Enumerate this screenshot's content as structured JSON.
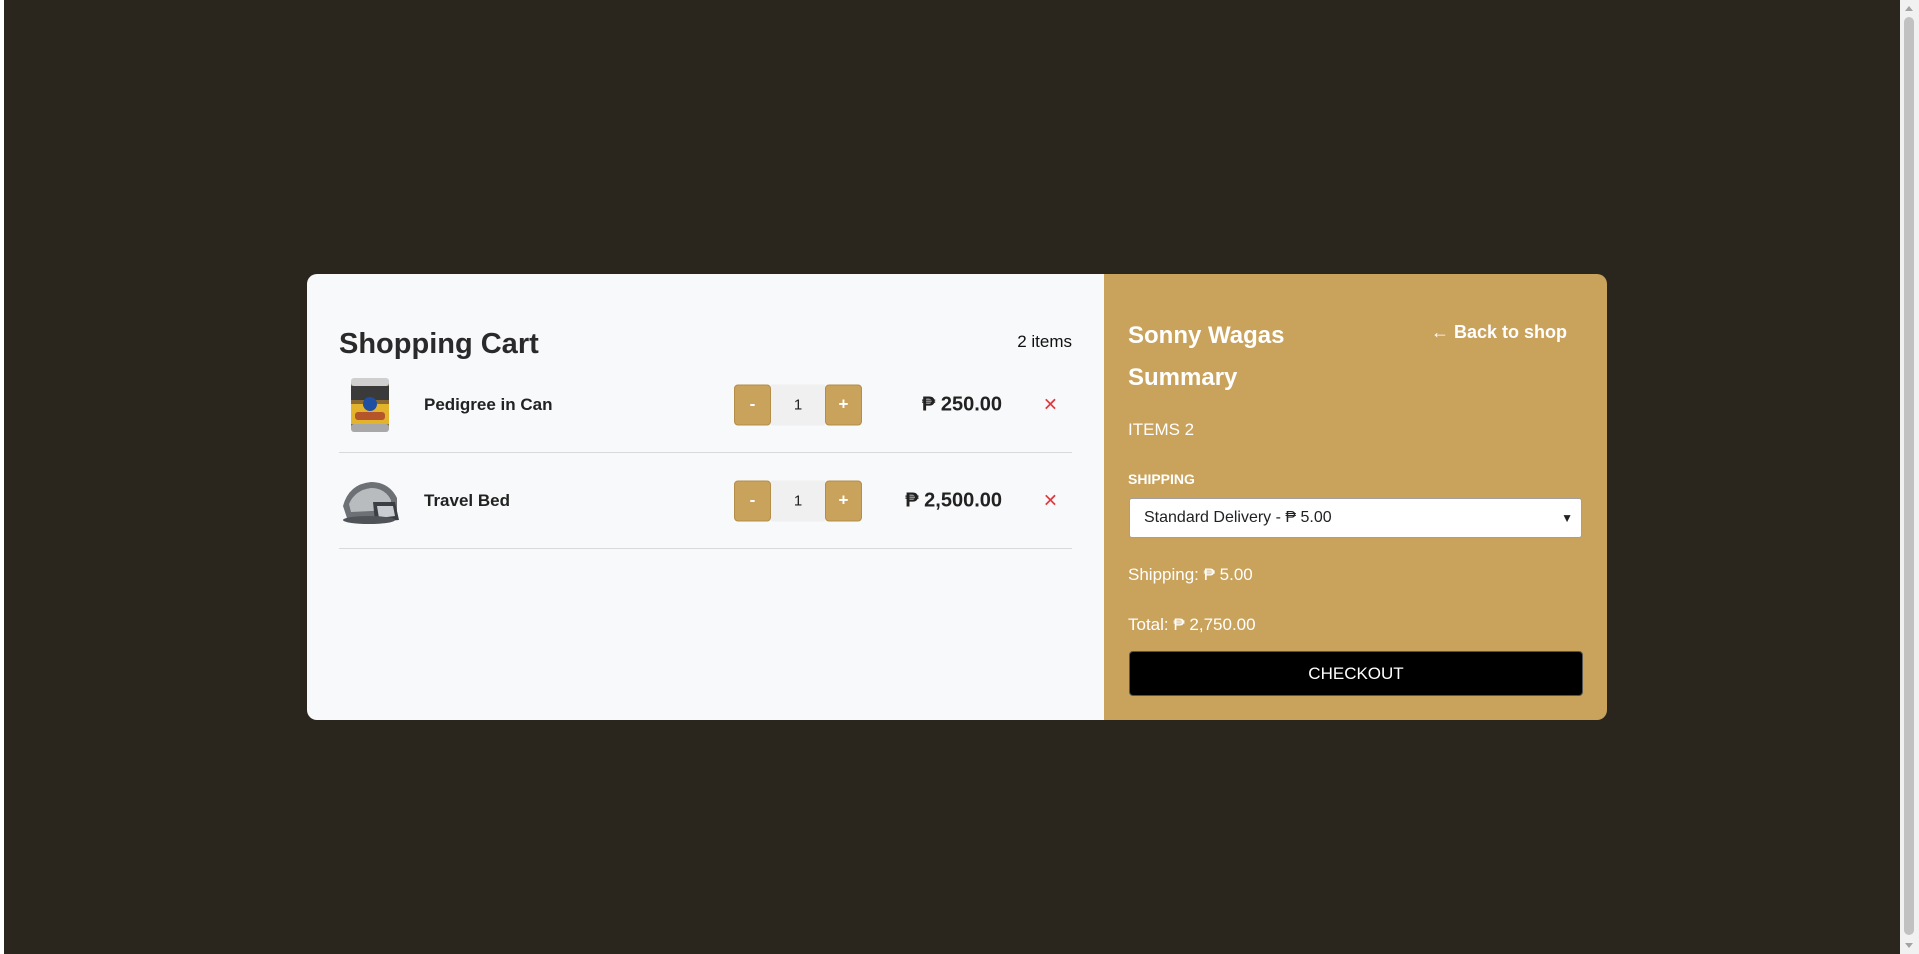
{
  "cart": {
    "title": "Shopping Cart",
    "item_count": "2 items",
    "items": [
      {
        "name": "Pedigree in Can",
        "quantity": "1",
        "price": "₱ 250.00",
        "decrement": "-",
        "increment": "+",
        "remove": "✕",
        "image": "pet-food-can-image"
      },
      {
        "name": "Travel Bed",
        "quantity": "1",
        "price": "₱ 2,500.00",
        "decrement": "-",
        "increment": "+",
        "remove": "✕",
        "image": "pet-travel-bed-image"
      }
    ]
  },
  "summary": {
    "brand": "Sonny Wagas",
    "back_link": "← Back to shop",
    "title": "Summary",
    "items_line": "ITEMS 2",
    "shipping_label": "SHIPPING",
    "shipping_option": "Standard Delivery - ₱ 5.00",
    "shipping_amount": "Shipping: ₱ 5.00",
    "total": "Total: ₱ 2,750.00",
    "checkout_label": "CHECKOUT"
  },
  "colors": {
    "background": "#2a261e",
    "accent": "#c9a25c",
    "remove": "#e0393e",
    "checkout": "#000000"
  }
}
